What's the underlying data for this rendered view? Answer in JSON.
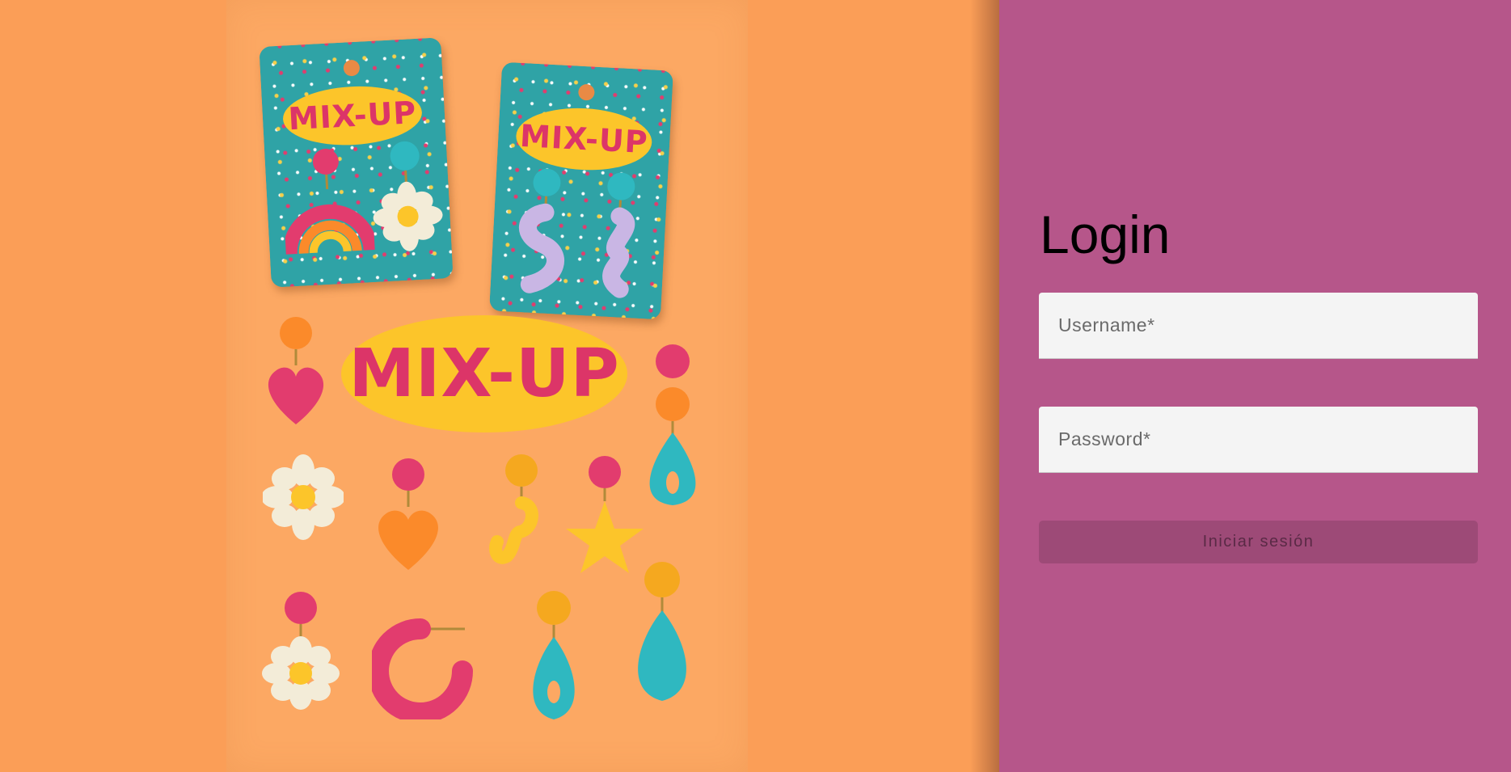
{
  "hero": {
    "brand_text": "MIX-UP",
    "background_color": "#fb9e57",
    "card_color": "#2fa3a6",
    "oval_color": "#fcc52a",
    "brand_text_color": "#dc3568"
  },
  "login": {
    "title": "Login",
    "username_placeholder": "Username*",
    "password_placeholder": "Password*",
    "submit_label": "Iniciar sesión",
    "panel_color": "#b6568a",
    "button_color": "#9d4a77"
  }
}
